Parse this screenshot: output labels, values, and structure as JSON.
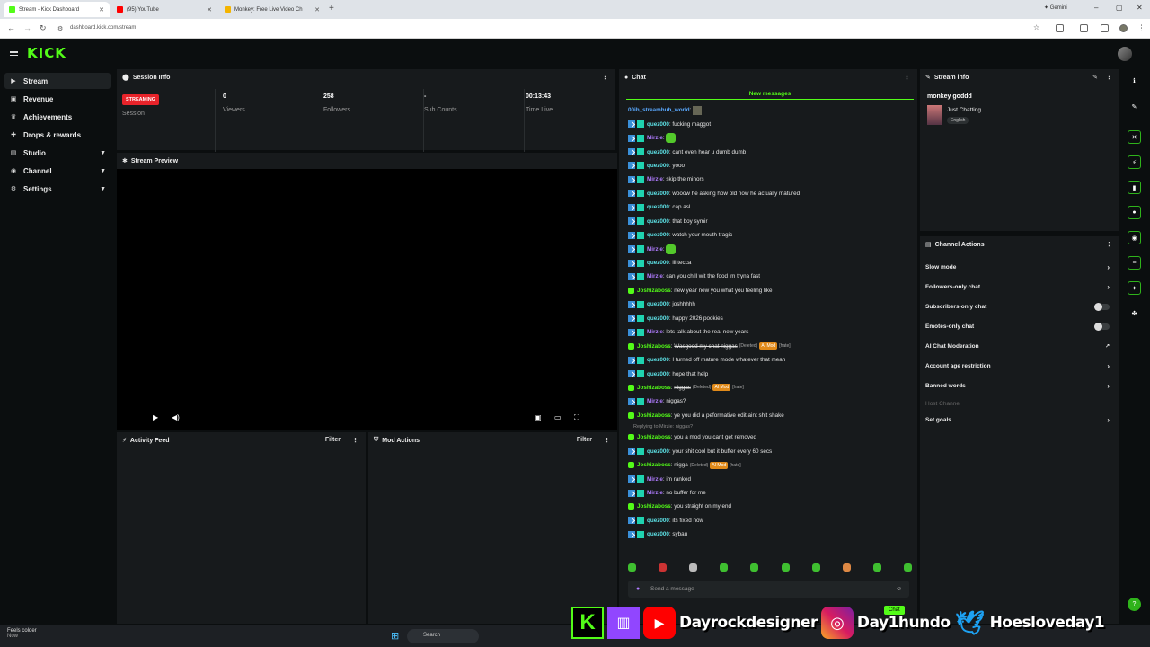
{
  "browser": {
    "tabs": [
      {
        "title": "Stream - Kick Dashboard",
        "active": true
      },
      {
        "title": "(95) YouTube",
        "active": false
      },
      {
        "title": "Monkey: Free Live Video Ch",
        "active": false
      }
    ],
    "url": "dashboard.kick.com/stream",
    "gemini_label": "Gemini"
  },
  "header": {
    "logo": "KICK"
  },
  "sidebar": {
    "items": [
      {
        "label": "Stream",
        "icon": "stream-icon",
        "active": true
      },
      {
        "label": "Revenue",
        "icon": "revenue-icon"
      },
      {
        "label": "Achievements",
        "icon": "trophy-icon"
      },
      {
        "label": "Drops & rewards",
        "icon": "gift-icon"
      },
      {
        "label": "Studio",
        "icon": "studio-icon",
        "expandable": true
      },
      {
        "label": "Channel",
        "icon": "channel-icon",
        "expandable": true
      },
      {
        "label": "Settings",
        "icon": "gear-icon",
        "expandable": true
      }
    ]
  },
  "session": {
    "title": "Session Info",
    "status_badge": "STREAMING",
    "status_label": "Session",
    "viewers_value": "0",
    "viewers_label": "Viewers",
    "followers_value": "258",
    "followers_label": "Followers",
    "subs_value": "-",
    "subs_label": "Sub Counts",
    "time_value": "00:13:43",
    "time_label": "Time Live"
  },
  "preview": {
    "title": "Stream Preview"
  },
  "activity": {
    "title": "Activity Feed",
    "filter": "Filter"
  },
  "modactions": {
    "title": "Mod Actions",
    "filter": "Filter"
  },
  "chat": {
    "title": "Chat",
    "new_messages": "New messages",
    "first_user": "00ib_streamhub_world",
    "lines": [
      {
        "user": "quez000",
        "text": "fucking maggot"
      },
      {
        "user": "Mirzie",
        "text": ""
      },
      {
        "user": "quez000",
        "text": "cant even hear u dumb dumb"
      },
      {
        "user": "quez000",
        "text": "yooo"
      },
      {
        "user": "Mirzie",
        "text": "skip the minors"
      },
      {
        "user": "quez000",
        "text": "wooow he asking how old now he actually matured"
      },
      {
        "user": "quez000",
        "text": "cap asl"
      },
      {
        "user": "quez000",
        "text": "that boy symir"
      },
      {
        "user": "quez000",
        "text": "watch your mouth tragic"
      },
      {
        "user": "Mirzie",
        "text": ""
      },
      {
        "user": "quez000",
        "text": "lil tecca"
      },
      {
        "user": "Mirzie",
        "text": "can you chill wit the food im tryna fast"
      },
      {
        "user": "Joshizaboss",
        "text": "new year new you what you feeling like"
      },
      {
        "user": "quez000",
        "text": "joshhhhh"
      },
      {
        "user": "quez000",
        "text": "happy 2026 pookies"
      },
      {
        "user": "Mirzie",
        "text": "lets talk about the real new years"
      },
      {
        "user": "Joshizaboss",
        "text": "Wasgood my chat niggas",
        "deleted": "(Deleted)",
        "ai": "AI Mod",
        "tag": "[hate]"
      },
      {
        "user": "quez000",
        "text": "I turned off mature mode whatever that mean"
      },
      {
        "user": "quez000",
        "text": "hope that help"
      },
      {
        "user": "Joshizaboss",
        "text": "niggas",
        "deleted": "(Deleted)",
        "ai": "AI Mod",
        "tag": "[hate]"
      },
      {
        "user": "Mirzie",
        "text": "niggas?"
      },
      {
        "user": "Joshizaboss",
        "text": "ye you did a peformative edit aint shit shake"
      },
      {
        "reply": "Replying to Mirzie: niggas?"
      },
      {
        "user": "Joshizaboss",
        "text": "you a mod you cant get removed"
      },
      {
        "user": "quez000",
        "text": "your shit cool but it buffer every 60 secs"
      },
      {
        "user": "Joshizaboss",
        "text": "nigga",
        "deleted": "(Deleted)",
        "ai": "AI Mod",
        "tag": "[hate]"
      },
      {
        "user": "Mirzie",
        "text": "im ranked"
      },
      {
        "user": "Mirzie",
        "text": "no buffer for me"
      },
      {
        "user": "Joshizaboss",
        "text": "you straight on my end"
      },
      {
        "user": "quez000",
        "text": "its fixed now"
      },
      {
        "user": "quez000",
        "text": "sybau"
      }
    ],
    "input_placeholder": "Send a message",
    "send_label": "Chat"
  },
  "stream_info": {
    "title": "Stream info",
    "stream_title": "monkey goddd",
    "category": "Just Chatting",
    "language": "English"
  },
  "channel_actions": {
    "title": "Channel Actions",
    "items": [
      {
        "label": "Slow mode",
        "control": "arrow"
      },
      {
        "label": "Followers-only chat",
        "control": "arrow"
      },
      {
        "label": "Subscribers-only chat",
        "control": "toggle"
      },
      {
        "label": "Emotes-only chat",
        "control": "toggle"
      },
      {
        "label": "AI Chat Moderation",
        "control": "external"
      },
      {
        "label": "Account age restriction",
        "control": "arrow"
      },
      {
        "label": "Banned words",
        "control": "arrow"
      },
      {
        "label": "Host Channel",
        "control": "none",
        "disabled": true
      },
      {
        "label": "Set goals",
        "control": "arrow"
      }
    ]
  },
  "taskbar": {
    "weather": "Feels colder",
    "weather_sub": "Now",
    "search": "Search"
  },
  "overlay": {
    "youtube": "Dayrockdesigner",
    "instagram": "Day1hundo",
    "twitter": "Hoesloveday1"
  },
  "colors": {
    "kick_green": "#53fc18",
    "panel": "#171a1c",
    "bg": "#0b0e0f",
    "streaming_red": "#e8232a"
  }
}
